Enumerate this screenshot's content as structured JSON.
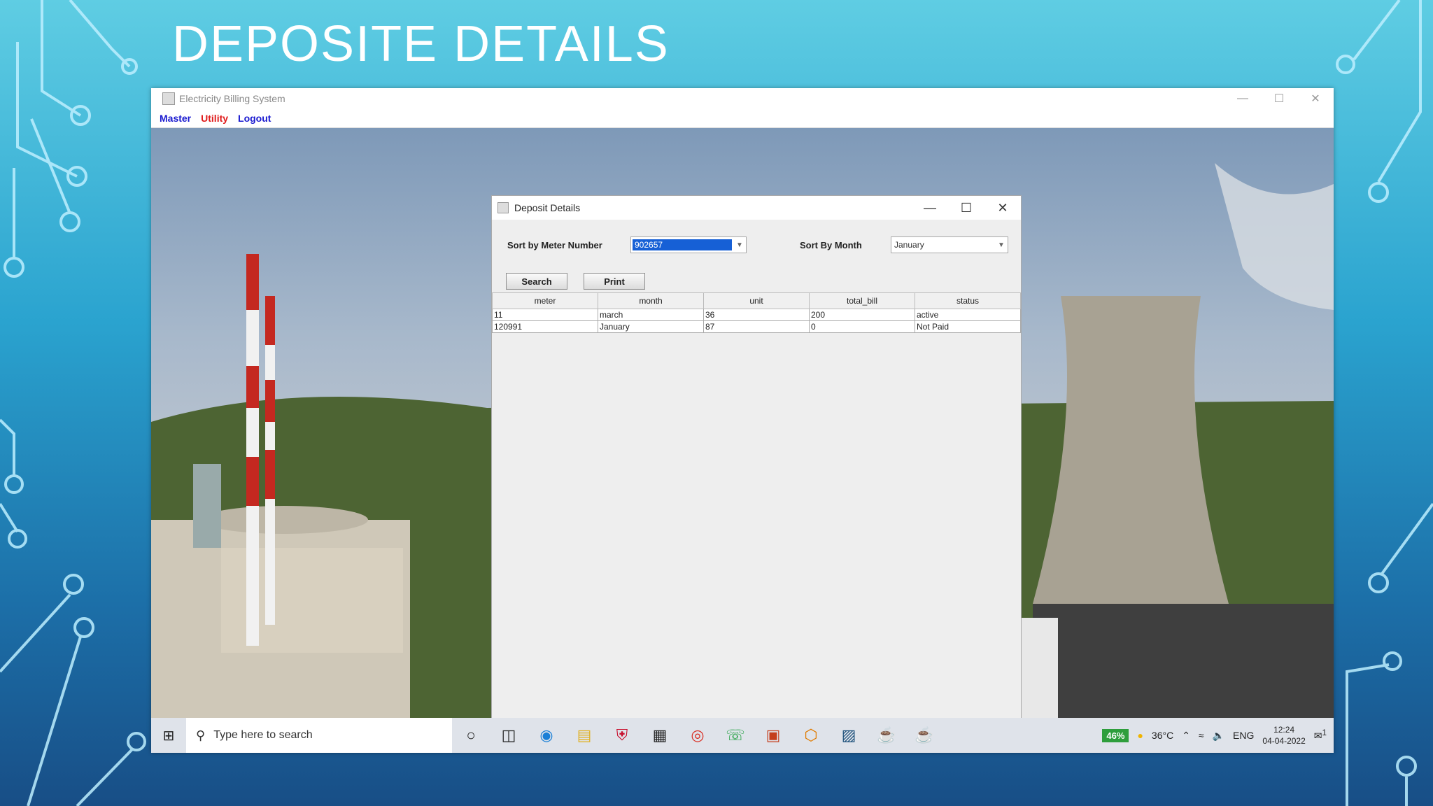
{
  "slide": {
    "title": "DEPOSITE DETAILS"
  },
  "app": {
    "title": "Electricity Billing System",
    "menu": {
      "master": "Master",
      "utility": "Utility",
      "logout": "Logout"
    },
    "controls": {
      "minimize": "—",
      "maximize": "☐",
      "close": "✕"
    }
  },
  "dialog": {
    "title": "Deposit Details",
    "controls": {
      "minimize": "—",
      "maximize": "☐",
      "close": "✕"
    },
    "filters": {
      "meter_label": "Sort by Meter Number",
      "meter_value": "902657",
      "month_label": "Sort By Month",
      "month_value": "January"
    },
    "buttons": {
      "search": "Search",
      "print": "Print"
    },
    "table": {
      "columns": [
        "meter",
        "month",
        "unit",
        "total_bill",
        "status"
      ],
      "rows": [
        [
          "11",
          "march",
          "36",
          "200",
          "active"
        ],
        [
          "120991",
          "January",
          "87",
          "0",
          "Not Paid"
        ]
      ]
    }
  },
  "taskbar": {
    "search_placeholder": "Type here to search",
    "battery": "46%",
    "temperature": "36°C",
    "language": "ENG",
    "time": "12:24",
    "date": "04-04-2022",
    "notification_count": "1",
    "icons": [
      "cortana-icon",
      "task-view-icon",
      "edge-icon",
      "file-explorer-icon",
      "mcafee-icon",
      "calculator-icon",
      "chrome-icon",
      "whatsapp-icon",
      "powerpoint-icon",
      "app-icon",
      "netbeans-icon",
      "java-icon",
      "java-icon"
    ]
  },
  "colors": {
    "menu_blue": "#1a1ad0",
    "menu_red": "#e01b1b",
    "selection": "#1660d6",
    "battery": "#2e9e3c"
  }
}
